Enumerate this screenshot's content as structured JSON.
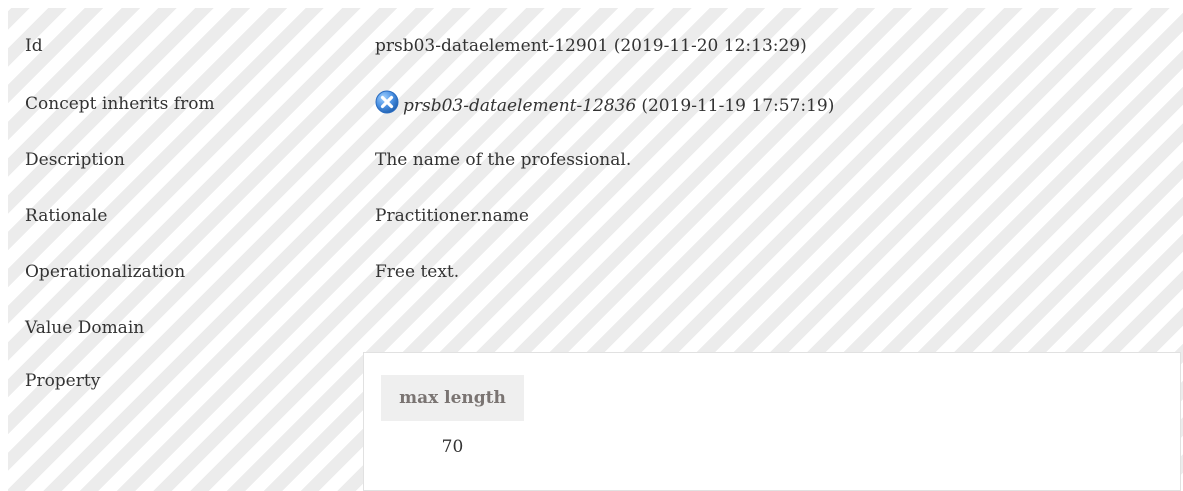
{
  "rows": {
    "id": {
      "label": "Id",
      "value": "prsb03-dataelement-12901 (2019-11-20 12:13:29)"
    },
    "inherits": {
      "label": "Concept inherits from",
      "link": "prsb03-dataelement-12836",
      "date": "(2019-11-19 17:57:19)",
      "icon": "close-circle-icon"
    },
    "description": {
      "label": "Description",
      "value": "The name of the professional."
    },
    "rationale": {
      "label": "Rationale",
      "value": "Practitioner.name"
    },
    "operationalization": {
      "label": "Operationalization",
      "value": "Free text."
    },
    "value_domain": {
      "label": "Value Domain",
      "value": ""
    },
    "property": {
      "label": "Property",
      "table_header": "max length",
      "table_value": "70"
    }
  },
  "colors": {
    "stripe_light": "#ffffff",
    "stripe_dark": "#ececec",
    "icon_blue": "#4a90e2",
    "header_bg": "#efefef",
    "header_text": "#7a7472",
    "text": "#333333"
  }
}
